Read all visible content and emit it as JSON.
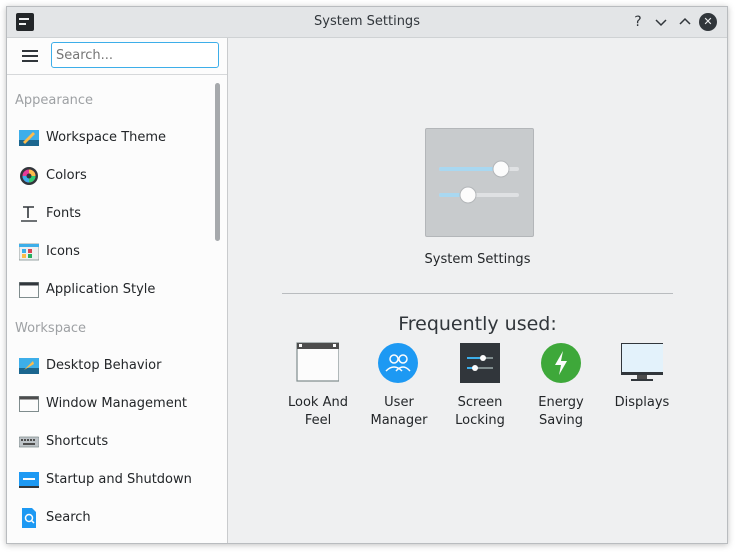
{
  "window": {
    "title": "System Settings",
    "help_glyph": "?",
    "minimize_glyph": "⌄",
    "maximize_glyph": "⌃",
    "close_glyph": "✕"
  },
  "sidebar": {
    "search_placeholder": "Search...",
    "categories": [
      {
        "label": "Appearance",
        "items": [
          {
            "label": "Workspace Theme",
            "icon": "workspace-theme-icon"
          },
          {
            "label": "Colors",
            "icon": "colors-icon"
          },
          {
            "label": "Fonts",
            "icon": "fonts-icon"
          },
          {
            "label": "Icons",
            "icon": "icons-icon"
          },
          {
            "label": "Application Style",
            "icon": "application-style-icon"
          }
        ]
      },
      {
        "label": "Workspace",
        "items": [
          {
            "label": "Desktop Behavior",
            "icon": "desktop-behavior-icon"
          },
          {
            "label": "Window Management",
            "icon": "window-management-icon"
          },
          {
            "label": "Shortcuts",
            "icon": "keyboard-icon"
          },
          {
            "label": "Startup and Shutdown",
            "icon": "startup-shutdown-icon"
          },
          {
            "label": "Search",
            "icon": "search-icon"
          }
        ]
      }
    ]
  },
  "main": {
    "hero_label": "System Settings",
    "frequently_used_title": "Frequently used:",
    "frequently_used": [
      {
        "line1": "Look And",
        "line2": "Feel",
        "icon": "look-and-feel-icon"
      },
      {
        "line1": "User",
        "line2": "Manager",
        "icon": "user-manager-icon"
      },
      {
        "line1": "Screen",
        "line2": "Locking",
        "icon": "screen-locking-icon"
      },
      {
        "line1": "Energy",
        "line2": "Saving",
        "icon": "energy-saving-icon"
      },
      {
        "line1": "Displays",
        "line2": "",
        "icon": "displays-icon"
      }
    ]
  },
  "colors": {
    "accent": "#3daee9",
    "energy_green": "#2ca02c",
    "user_blue": "#1d99f3"
  }
}
